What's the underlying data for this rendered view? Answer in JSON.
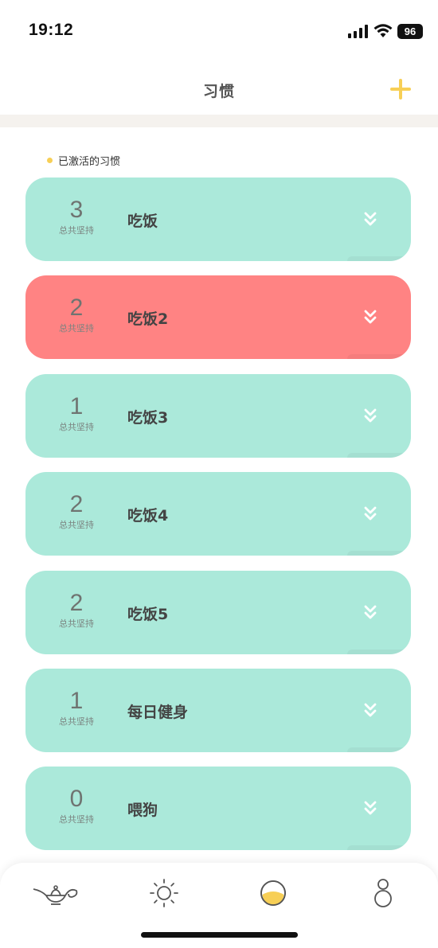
{
  "status_bar": {
    "time": "19:12",
    "battery": "96"
  },
  "nav": {
    "title": "习惯",
    "add_icon": "plus-icon"
  },
  "section": {
    "label": "已激活的习惯"
  },
  "habits": [
    {
      "count": "3",
      "count_label": "总共坚持",
      "name": "吃饭",
      "color": "#abe9da"
    },
    {
      "count": "2",
      "count_label": "总共坚持",
      "name": "吃饭2",
      "color": "#ff8383"
    },
    {
      "count": "1",
      "count_label": "总共坚持",
      "name": "吃饭3",
      "color": "#abe9da"
    },
    {
      "count": "2",
      "count_label": "总共坚持",
      "name": "吃饭4",
      "color": "#abe9da"
    },
    {
      "count": "2",
      "count_label": "总共坚持",
      "name": "吃饭5",
      "color": "#abe9da"
    },
    {
      "count": "1",
      "count_label": "总共坚持",
      "name": "每日健身",
      "color": "#abe9da"
    },
    {
      "count": "0",
      "count_label": "总共坚持",
      "name": "喂狗",
      "color": "#abe9da"
    }
  ],
  "tabs": [
    {
      "icon": "magic-lamp-icon"
    },
    {
      "icon": "sun-icon"
    },
    {
      "icon": "moon-icon",
      "active": true
    },
    {
      "icon": "person-icon"
    }
  ],
  "colors": {
    "accent": "#f7cf56",
    "card_default": "#abe9da",
    "card_highlight": "#ff8383"
  }
}
